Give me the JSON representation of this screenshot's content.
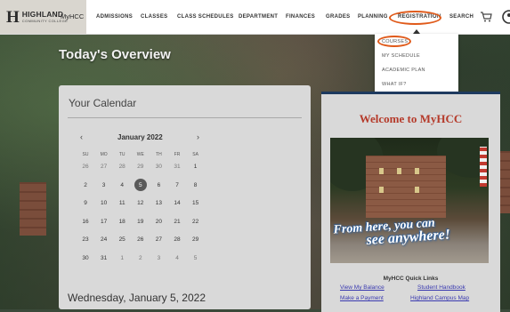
{
  "header": {
    "logo_mark": "H",
    "logo_name": "HIGHLAND",
    "logo_sub": "COMMUNITY COLLEGE",
    "logo_app": "MyHCC",
    "nav": [
      "ADMISSIONS",
      "CLASSES",
      "CLASS SCHEDULES",
      "DEPARTMENT",
      "FINANCES",
      "GRADES",
      "PLANNING",
      "REGISTRATION",
      "SEARCH"
    ],
    "icons": [
      "cart-icon",
      "account-icon"
    ]
  },
  "registration_menu": {
    "items": [
      "COURSES",
      "MY SCHEDULE",
      "ACADEMIC PLAN",
      "WHAT IF?"
    ],
    "highlighted": "COURSES"
  },
  "page": {
    "title": "Today's Overview"
  },
  "calendar": {
    "title": "Your Calendar",
    "month_label": "January 2022",
    "prev_arrow": "‹",
    "next_arrow": "›",
    "weekdays": [
      "SU",
      "MO",
      "TU",
      "WE",
      "TH",
      "FR",
      "SA"
    ],
    "weeks": [
      [
        [
          "26",
          1
        ],
        [
          "27",
          1
        ],
        [
          "28",
          1
        ],
        [
          "29",
          1
        ],
        [
          "30",
          1
        ],
        [
          "31",
          1
        ],
        [
          "1",
          0
        ]
      ],
      [
        [
          "2",
          0
        ],
        [
          "3",
          0
        ],
        [
          "4",
          0
        ],
        [
          "5",
          0
        ],
        [
          "6",
          0
        ],
        [
          "7",
          0
        ],
        [
          "8",
          0
        ]
      ],
      [
        [
          "9",
          0
        ],
        [
          "10",
          0
        ],
        [
          "11",
          0
        ],
        [
          "12",
          0
        ],
        [
          "13",
          0
        ],
        [
          "14",
          0
        ],
        [
          "15",
          0
        ]
      ],
      [
        [
          "16",
          0
        ],
        [
          "17",
          0
        ],
        [
          "18",
          0
        ],
        [
          "19",
          0
        ],
        [
          "20",
          0
        ],
        [
          "21",
          0
        ],
        [
          "22",
          0
        ]
      ],
      [
        [
          "23",
          0
        ],
        [
          "24",
          0
        ],
        [
          "25",
          0
        ],
        [
          "26",
          0
        ],
        [
          "27",
          0
        ],
        [
          "28",
          0
        ],
        [
          "29",
          0
        ]
      ],
      [
        [
          "30",
          0
        ],
        [
          "31",
          0
        ],
        [
          "1",
          1
        ],
        [
          "2",
          1
        ],
        [
          "3",
          1
        ],
        [
          "4",
          1
        ],
        [
          "5",
          1
        ]
      ]
    ],
    "selected": "5",
    "date_heading": "Wednesday, January 5, 2022"
  },
  "welcome": {
    "title": "Welcome to MyHCC",
    "tagline_1": "From here, you can",
    "tagline_2": "see anywhere!",
    "quick_links_title": "MyHCC Quick Links",
    "quick_links": [
      "View My Balance",
      "Student Handbook",
      "Make a Payment",
      "Highland Campus Map"
    ]
  },
  "colors": {
    "accent_oval": "#e05a1a",
    "welcome_red": "#b53a2a",
    "link": "#3a3ab0",
    "navy": "#1e3a5f"
  }
}
